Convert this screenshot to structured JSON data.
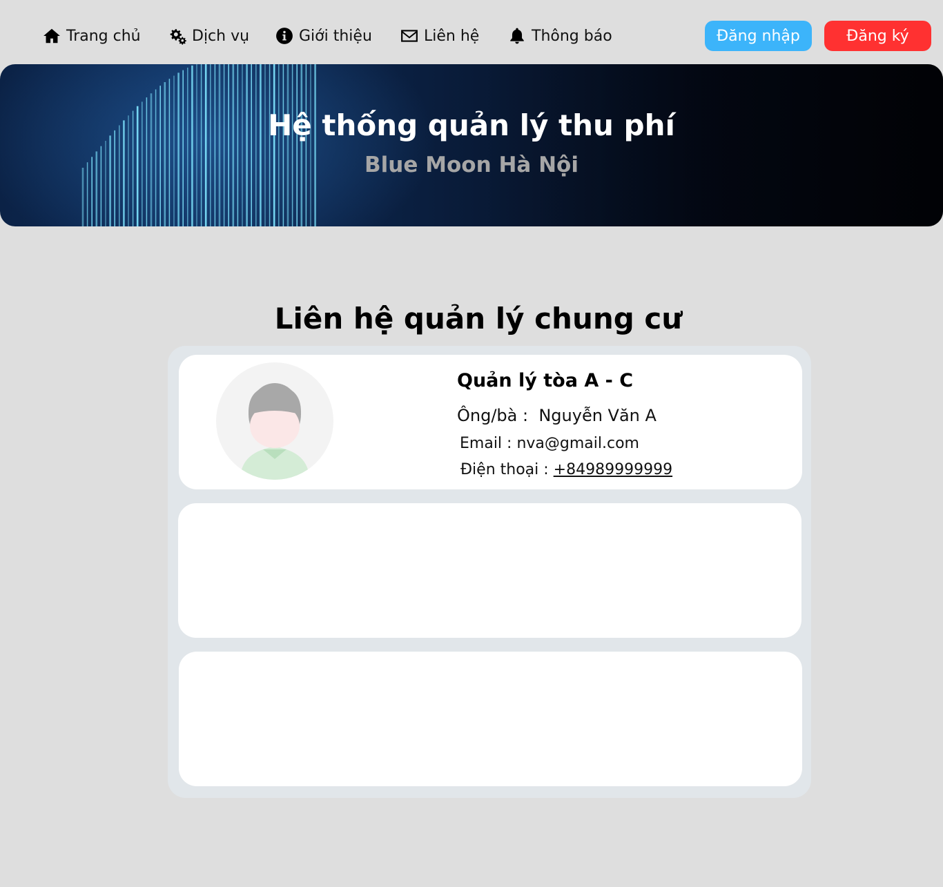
{
  "nav": {
    "items": [
      {
        "label": "Trang chủ",
        "icon": "home-icon"
      },
      {
        "label": "Dịch vụ",
        "icon": "gears-icon"
      },
      {
        "label": "Giới thiệu",
        "icon": "info-icon"
      },
      {
        "label": "Liên hệ",
        "icon": "envelope-icon"
      },
      {
        "label": "Thông báo",
        "icon": "bell-icon"
      }
    ],
    "login_label": "Đăng nhập",
    "register_label": "Đăng ký"
  },
  "hero": {
    "title": "Hệ thống quản lý thu phí",
    "subtitle": "Blue Moon Hà Nội"
  },
  "section": {
    "title": "Liên hệ quản lý chung cư"
  },
  "contacts": [
    {
      "heading": "Quản lý tòa A - C",
      "name_label": "Ông/bà :",
      "name": "Nguyễn Văn A",
      "email_label": "Email :",
      "email": "nva@gmail.com",
      "phone_label": "Điện thoại :",
      "phone": "+84989999999"
    }
  ],
  "colors": {
    "login_button": "#3cb4fa",
    "register_button": "#ff3131",
    "hero_subtitle": "#a6a6a6",
    "page_background": "#dedede",
    "panel_background": "#e1e6ea"
  }
}
